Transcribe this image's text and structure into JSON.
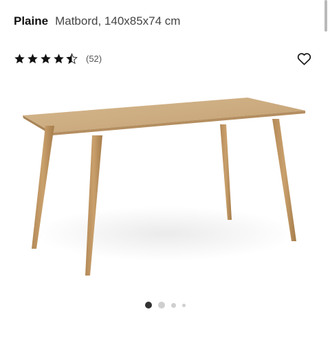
{
  "product": {
    "name": "Plaine",
    "description": "Matbord, 140x85x74 cm"
  },
  "rating": {
    "value": 4.5,
    "max": 5,
    "review_count": "(52)"
  },
  "favorite": {
    "icon": "heart-outline-icon"
  },
  "carousel": {
    "active_index": 0,
    "image_count": 4
  },
  "colors": {
    "text": "#111111",
    "muted": "#555555",
    "dot_active": "#333333",
    "dot_inactive": "#cfcfcf"
  }
}
